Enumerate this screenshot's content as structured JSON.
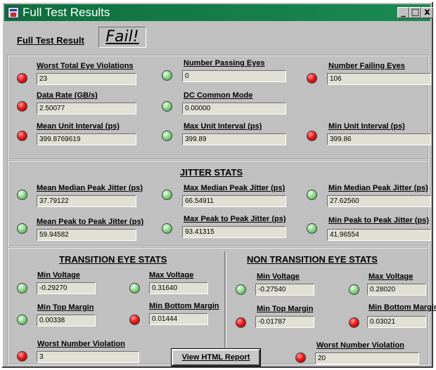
{
  "window": {
    "title": "Full Test Results",
    "controls": {
      "minimize": "_",
      "maximize": "□",
      "close": "x"
    }
  },
  "summary": {
    "label": "Full Test Result",
    "result": "Fail!"
  },
  "top": {
    "worst_total_eye_violations": {
      "label": "Worst Total Eye Violations",
      "value": "23",
      "status": "red"
    },
    "number_passing_eyes": {
      "label": "Number Passing Eyes",
      "value": "0",
      "status": "green"
    },
    "number_failing_eyes": {
      "label": "Number Failing Eyes",
      "value": "106",
      "status": "red"
    },
    "data_rate": {
      "label": "Data Rate (GB/s)",
      "value": "2.50077",
      "status": "red"
    },
    "dc_common_mode": {
      "label": "DC Common Mode",
      "value": "0.00000",
      "status": "green"
    },
    "mean_unit_interval": {
      "label": "Mean Unit Interval (ps)",
      "value": "399.8769619",
      "status": "red"
    },
    "max_unit_interval": {
      "label": "Max Unit Interval (ps)",
      "value": "399.89",
      "status": "green"
    },
    "min_unit_interval": {
      "label": "Min Unit Interval (ps)",
      "value": "399.86",
      "status": "red"
    }
  },
  "jitter": {
    "title": "JITTER STATS",
    "mean_median_peak": {
      "label": "Mean Median Peak Jitter (ps)",
      "value": "37.79122",
      "status": "green"
    },
    "max_median_peak": {
      "label": "Max Median Peak Jitter (ps)",
      "value": "66.54911",
      "status": "green"
    },
    "min_median_peak": {
      "label": "Min Median Peak Jitter (ps)",
      "value": "27.62560",
      "status": "green"
    },
    "mean_peak_to_peak": {
      "label": "Mean Peak to Peak Jitter (ps)",
      "value": "59.94582",
      "status": "green"
    },
    "max_peak_to_peak": {
      "label": "Max Peak to Peak Jitter (ps)",
      "value": "93.41315",
      "status": "green"
    },
    "min_peak_to_peak": {
      "label": "Min Peak to Peak Jitter (ps)",
      "value": "41.96554",
      "status": "green"
    }
  },
  "transition": {
    "title": "TRANSITION EYE STATS",
    "min_voltage": {
      "label": "Min Voltage",
      "value": "-0.29270",
      "status": "green"
    },
    "max_voltage": {
      "label": "Max Voltage",
      "value": "0.31640",
      "status": "green"
    },
    "min_top_margin": {
      "label": "Min Top Margin",
      "value": "0.00338",
      "status": "green"
    },
    "min_bottom_margin": {
      "label": "Min Bottom Margin",
      "value": "0.01444",
      "status": "red"
    },
    "worst_number_violation": {
      "label": "Worst Number Violation",
      "value": "3",
      "status": "red"
    }
  },
  "non_transition": {
    "title": "NON TRANSITION EYE STATS",
    "min_voltage": {
      "label": "Min Voltage",
      "value": "-0.27540",
      "status": "green"
    },
    "max_voltage": {
      "label": "Max Voltage",
      "value": "0.28020",
      "status": "green"
    },
    "min_top_margin": {
      "label": "Min Top Margin",
      "value": "-0.01787",
      "status": "red"
    },
    "min_bottom_margin": {
      "label": "Min Bottom Margin",
      "value": "0.03021",
      "status": "red"
    },
    "worst_number_violation": {
      "label": "Worst Number Violation",
      "value": "20",
      "status": "red"
    }
  },
  "actions": {
    "view_html_report": "View HTML Report"
  }
}
